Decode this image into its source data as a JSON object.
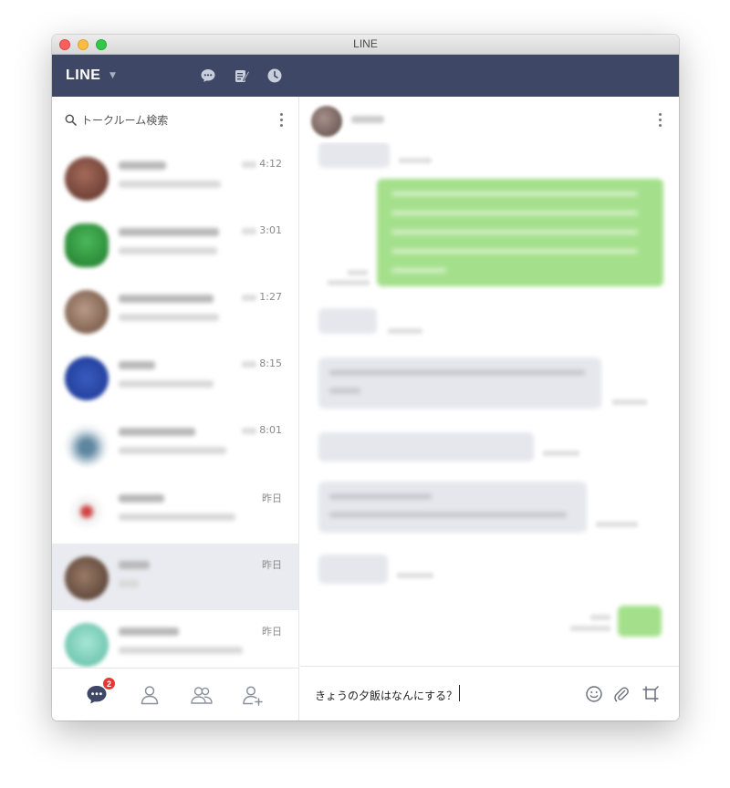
{
  "window": {
    "title": "LINE"
  },
  "header": {
    "logo": "LINE",
    "icons": [
      "chat-bubble-icon",
      "note-icon",
      "clock-icon"
    ]
  },
  "sidebar": {
    "search_placeholder": "トークルーム検索",
    "chats": [
      {
        "time": "4:12",
        "avatar_color": "#7a4a3e"
      },
      {
        "time": "3:01",
        "avatar_color": "#2f9a3c"
      },
      {
        "time": "1:27",
        "avatar_color": "#8a6a58"
      },
      {
        "time": "8:15",
        "avatar_color": "#1f3f9a"
      },
      {
        "time": "8:01",
        "avatar_color": "#6c8fa8"
      },
      {
        "time": "昨日",
        "avatar_color": "#d8d8d8"
      },
      {
        "time": "昨日",
        "avatar_color": "#7a5c4c"
      },
      {
        "time": "昨日",
        "avatar_color": "#8cd6c4"
      }
    ],
    "selected_index": 6
  },
  "bottom_nav": {
    "badge": "2",
    "icons": [
      "chats-icon",
      "friends-icon",
      "groups-icon",
      "add-friend-icon"
    ]
  },
  "composer": {
    "value": "きょうの夕飯はなんにする？"
  },
  "colors": {
    "header_bg": "#3e4866",
    "outgoing_bubble": "#a4e08b",
    "incoming_bubble": "#e6e7ed",
    "badge": "#e53935"
  }
}
